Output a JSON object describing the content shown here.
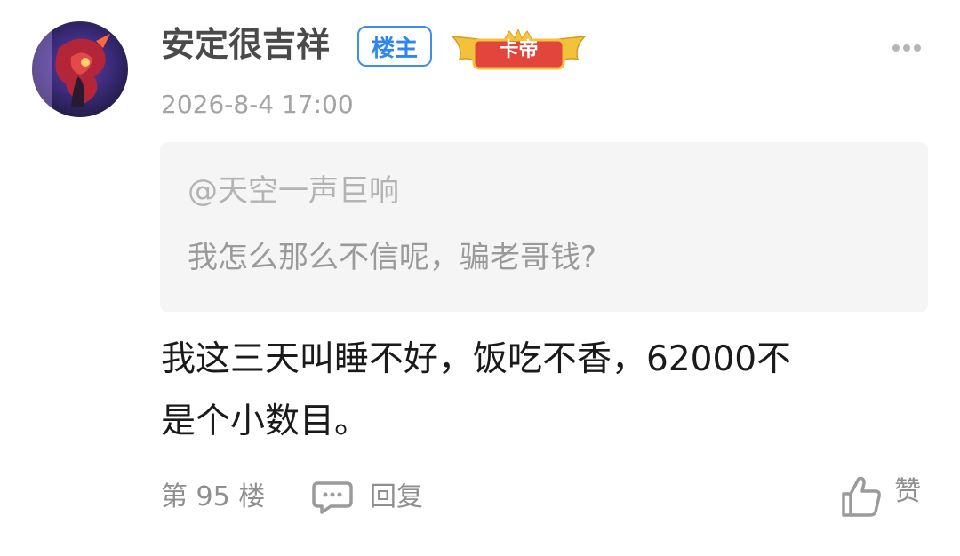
{
  "post": {
    "username": "安定很吉祥",
    "op_badge": "楼主",
    "level_badge": "卡帝",
    "timestamp": "2026-8-4 17:00",
    "quote": {
      "author": "@天空一声巨响",
      "text": "我怎么那么不信呢，骗老哥钱?"
    },
    "content_lines": [
      "我这三天叫睡不好，饭吃不香，62000不",
      "是个小数目。"
    ]
  },
  "footer": {
    "floor": "第 95 楼",
    "reply_label": "回复",
    "like_label": "赞"
  },
  "icons": {
    "more": "more-dots-icon",
    "reply": "comment-bubble-icon",
    "like": "thumbs-up-icon"
  },
  "colors": {
    "accent_blue": "#2f86ee",
    "badge_gold": "#f2c23a",
    "badge_red": "#e2453c",
    "quote_bg": "#f5f5f5"
  }
}
